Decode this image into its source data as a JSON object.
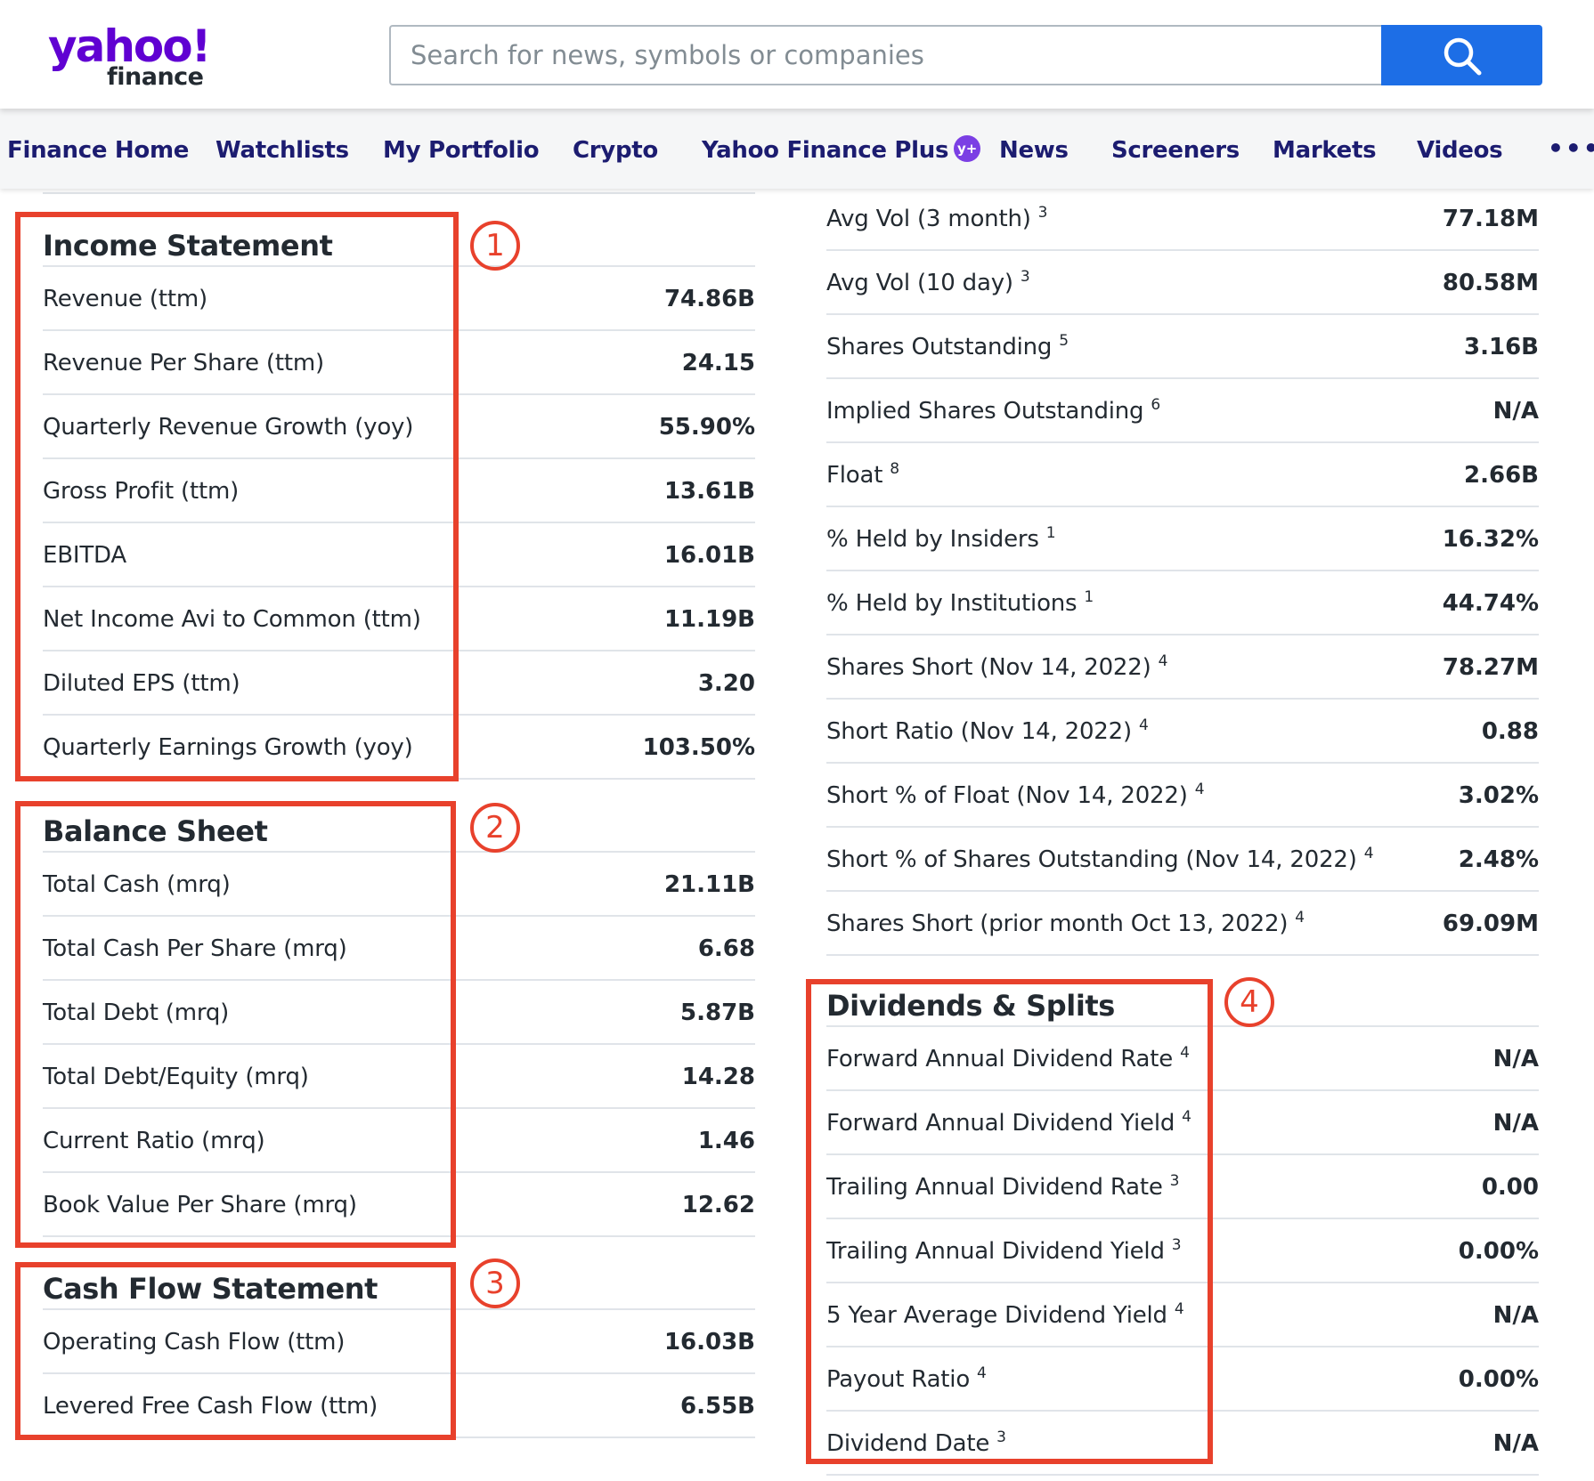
{
  "header": {
    "logo_text": "yahoo!",
    "logo_sub": "finance",
    "search_placeholder": "Search for news, symbols or companies"
  },
  "nav": {
    "items": [
      {
        "label": "Finance Home"
      },
      {
        "label": "Watchlists"
      },
      {
        "label": "My Portfolio"
      },
      {
        "label": "Crypto"
      },
      {
        "label": "Yahoo Finance Plus",
        "badge": "y+"
      },
      {
        "label": "News"
      },
      {
        "label": "Screeners"
      },
      {
        "label": "Markets"
      },
      {
        "label": "Videos"
      }
    ],
    "more": "•••"
  },
  "annotations": [
    "1",
    "2",
    "3",
    "4"
  ],
  "income_statement": {
    "title": "Income Statement",
    "rows": [
      {
        "label": "Revenue (ttm)",
        "value": "74.86B"
      },
      {
        "label": "Revenue Per Share (ttm)",
        "value": "24.15"
      },
      {
        "label": "Quarterly Revenue Growth (yoy)",
        "value": "55.90%"
      },
      {
        "label": "Gross Profit (ttm)",
        "value": "13.61B"
      },
      {
        "label": "EBITDA",
        "value": "16.01B"
      },
      {
        "label": "Net Income Avi to Common (ttm)",
        "value": "11.19B"
      },
      {
        "label": "Diluted EPS (ttm)",
        "value": "3.20"
      },
      {
        "label": "Quarterly Earnings Growth (yoy)",
        "value": "103.50%"
      }
    ]
  },
  "balance_sheet": {
    "title": "Balance Sheet",
    "rows": [
      {
        "label": "Total Cash (mrq)",
        "value": "21.11B"
      },
      {
        "label": "Total Cash Per Share (mrq)",
        "value": "6.68"
      },
      {
        "label": "Total Debt (mrq)",
        "value": "5.87B"
      },
      {
        "label": "Total Debt/Equity (mrq)",
        "value": "14.28"
      },
      {
        "label": "Current Ratio (mrq)",
        "value": "1.46"
      },
      {
        "label": "Book Value Per Share (mrq)",
        "value": "12.62"
      }
    ]
  },
  "cash_flow": {
    "title": "Cash Flow Statement",
    "rows": [
      {
        "label": "Operating Cash Flow (ttm)",
        "value": "16.03B"
      },
      {
        "label": "Levered Free Cash Flow (ttm)",
        "value": "6.55B"
      }
    ]
  },
  "share_statistics": {
    "rows": [
      {
        "label": "Avg Vol (3 month)",
        "note": "3",
        "value": "77.18M"
      },
      {
        "label": "Avg Vol (10 day)",
        "note": "3",
        "value": "80.58M"
      },
      {
        "label": "Shares Outstanding",
        "note": "5",
        "value": "3.16B"
      },
      {
        "label": "Implied Shares Outstanding",
        "note": "6",
        "value": "N/A"
      },
      {
        "label": "Float",
        "note": "8",
        "value": "2.66B"
      },
      {
        "label": "% Held by Insiders",
        "note": "1",
        "value": "16.32%"
      },
      {
        "label": "% Held by Institutions",
        "note": "1",
        "value": "44.74%"
      },
      {
        "label": "Shares Short (Nov 14, 2022)",
        "note": "4",
        "value": "78.27M"
      },
      {
        "label": "Short Ratio (Nov 14, 2022)",
        "note": "4",
        "value": "0.88"
      },
      {
        "label": "Short % of Float (Nov 14, 2022)",
        "note": "4",
        "value": "3.02%"
      },
      {
        "label": "Short % of Shares Outstanding (Nov 14, 2022)",
        "note": "4",
        "value": "2.48%"
      },
      {
        "label": "Shares Short (prior month Oct 13, 2022)",
        "note": "4",
        "value": "69.09M"
      }
    ]
  },
  "dividends_splits": {
    "title": "Dividends & Splits",
    "rows": [
      {
        "label": "Forward Annual Dividend Rate",
        "note": "4",
        "value": "N/A"
      },
      {
        "label": "Forward Annual Dividend Yield",
        "note": "4",
        "value": "N/A"
      },
      {
        "label": "Trailing Annual Dividend Rate",
        "note": "3",
        "value": "0.00"
      },
      {
        "label": "Trailing Annual Dividend Yield",
        "note": "3",
        "value": "0.00%"
      },
      {
        "label": "5 Year Average Dividend Yield",
        "note": "4",
        "value": "N/A"
      },
      {
        "label": "Payout Ratio",
        "note": "4",
        "value": "0.00%"
      },
      {
        "label": "Dividend Date",
        "note": "3",
        "value": "N/A"
      }
    ]
  }
}
